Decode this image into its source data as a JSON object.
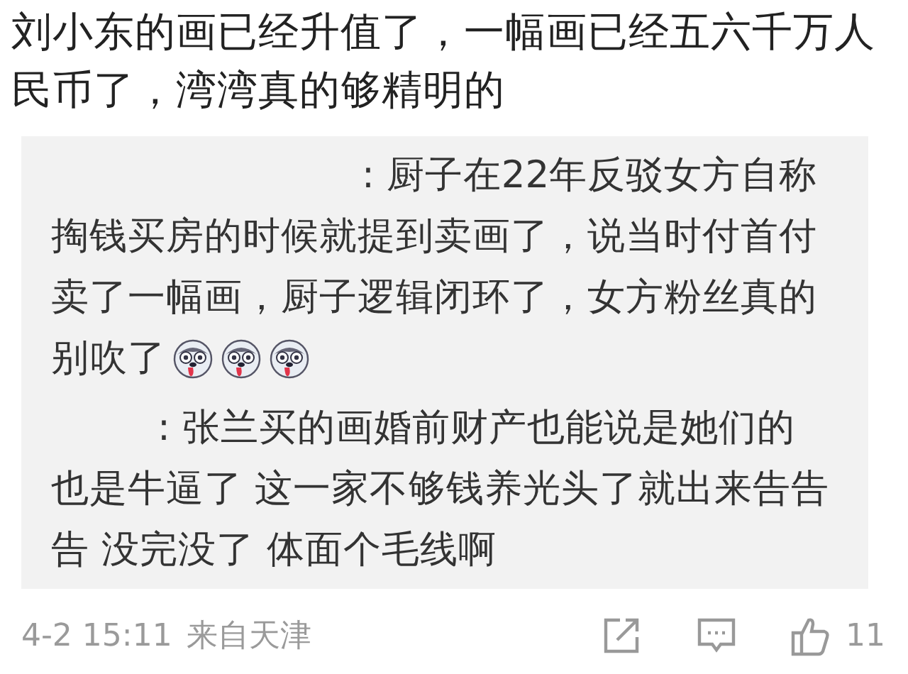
{
  "post": {
    "text": "刘小东的画已经升值了，一幅画已经五六千万人民币了，湾湾真的够精明的"
  },
  "replies": [
    {
      "text": ": 厨子在22年反驳女方自称掏钱买房的时候就提到卖画了，说当时付首付卖了一幅画，厨子逻辑闭环了，女方粉丝真的",
      "text_tail": "别吹了",
      "emojis": [
        {
          "kind": "dog-face"
        },
        {
          "kind": "dog-face"
        },
        {
          "kind": "dog-face"
        }
      ]
    },
    {
      "text": ": 张兰买的画婚前财产也能说是她们的也是牛逼了 这一家不够钱养光头了就出来告告告 没完没了 体面个毛线啊"
    }
  ],
  "footer": {
    "time": "4-2 15:11",
    "location": "来自天津",
    "likes": "11"
  }
}
